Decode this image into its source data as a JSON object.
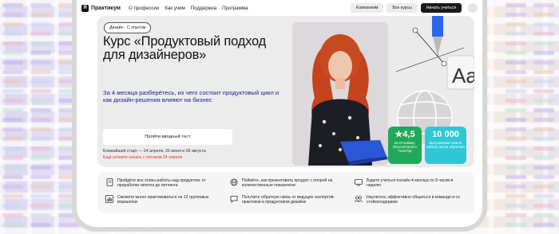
{
  "nav": {
    "logo_text": "Практикум",
    "logo_mark": "Я",
    "links": [
      "О профессии",
      "Как учим",
      "Поддержка",
      "Программа"
    ],
    "companies_label": "Компаниям",
    "all_courses_label": "Все курсы",
    "start_label": "Начать учиться"
  },
  "hero": {
    "tag": "Дизайн · С опытом",
    "title": "Курс «Продуктовый подход для дизайнеров»",
    "subtitle": "За 4 месяца разберётесь, из чего состоит продуктовый цикл и как дизайн-решения влияют на бизнес",
    "cta_label": "Пройти вводный тест",
    "start_dates": "Ближайший старт — 24 апреля, 26 июня и 28 августа",
    "hurry": "Ещё успеете начать с потоком 24 апреля",
    "deco_text": "Aa"
  },
  "badges": {
    "rating_value": "4,5",
    "rating_text": "на Отзовике, IRecommend и TutorTop",
    "count_value": "10 000",
    "count_text": "выпускников нашли работу после обучения"
  },
  "features": [
    {
      "icon": "document-icon",
      "text": "Пройдёте все этапы работы над продуктом: от проработки гипотез до питчинга"
    },
    {
      "icon": "globe-icon",
      "text": "Поймёте, как презентовать продукт с опорой на количественные показатели"
    },
    {
      "icon": "monitor-icon",
      "text": "Будете учиться онлайн 4 месяца по 8 часов в неделю"
    },
    {
      "icon": "chart-icon",
      "text": "Сможете много практиковаться на 12 групповых воркшопах"
    },
    {
      "icon": "chat-icon",
      "text": "Получите обратную связь от ведущих экспертов-практиков в продуктовом дизайне"
    },
    {
      "icon": "team-icon",
      "text": "Научитесь эффективно общаться в команде и со стейкхолдерами"
    }
  ],
  "colors": {
    "accent_text": "#1b1a8c",
    "hurry_red": "#e0301e",
    "rating_green": "#22a85b",
    "count_cyan": "#2fc7d6"
  }
}
